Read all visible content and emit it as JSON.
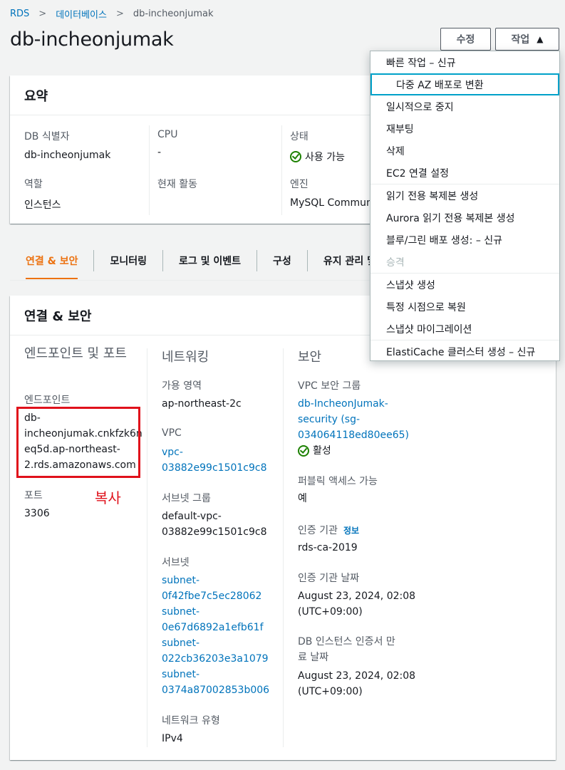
{
  "breadcrumb": {
    "root": "RDS",
    "databases": "데이터베이스",
    "current": "db-incheonjumak"
  },
  "page": {
    "title": "db-incheonjumak"
  },
  "buttons": {
    "edit": "수정",
    "action": "작업",
    "action_caret": "▲"
  },
  "summary": {
    "title": "요약",
    "db_id_label": "DB 식별자",
    "db_id_value": "db-incheonjumak",
    "role_label": "역할",
    "role_value": "인스턴스",
    "cpu_label": "CPU",
    "cpu_value": "-",
    "activity_label": "현재 활동",
    "status_label": "상태",
    "status_value": "사용 가능",
    "engine_label": "엔진",
    "engine_value": "MySQL Communit"
  },
  "tabs": [
    {
      "label": "연결 & 보안",
      "active": true
    },
    {
      "label": "모니터링"
    },
    {
      "label": "로그 및 이벤트"
    },
    {
      "label": "구성"
    },
    {
      "label": "유지 관리 및"
    }
  ],
  "connectivity": {
    "title": "연결 & 보안",
    "endpoint_section": "엔드포인트 및 포트",
    "endpoint_label": "엔드포인트",
    "endpoint_lines": [
      "db-",
      "incheonjumak.cnkfzk6n",
      "eq5d.ap-northeast-",
      "2.rds.amazonaws.com"
    ],
    "port_label": "포트",
    "port_value": "3306",
    "annotation": "복사",
    "networking_section": "네트워킹",
    "az_label": "가용 영역",
    "az_value": "ap-northeast-2c",
    "vpc_label": "VPC",
    "vpc_lines": [
      "vpc-",
      "03882e99c1501c9c8"
    ],
    "subnet_group_label": "서브넷 그룹",
    "subnet_group_lines": [
      "default-vpc-",
      "03882e99c1501c9c8"
    ],
    "subnets_label": "서브넷",
    "subnet_lines": [
      "subnet-",
      "0f42fbe7c5ec28062",
      "subnet-",
      "0e67d6892a1efb61f",
      "subnet-",
      "022cb36203e3a1079",
      "subnet-",
      "0374a87002853b006"
    ],
    "network_type_label": "네트워크 유형",
    "network_type_value": "IPv4",
    "security_section": "보안",
    "sg_label": "VPC 보안 그룹",
    "sg_lines": [
      "db-IncheonJumak-",
      "security (sg-",
      "034064118ed80ee65)"
    ],
    "sg_status": "활성",
    "public_label": "퍼블릭 액세스 가능",
    "public_value": "예",
    "ca_label": "인증 기관",
    "ca_info": "정보",
    "ca_value": "rds-ca-2019",
    "ca_date_label": "인증 기관 날짜",
    "ca_date_lines": [
      "August 23, 2024, 02:08",
      "(UTC+09:00)"
    ],
    "cert_label_lines": [
      "DB 인스턴스 인증서 만",
      "료 날짜"
    ],
    "cert_date_lines": [
      "August 23, 2024, 02:08",
      "(UTC+09:00)"
    ]
  },
  "dropdown": {
    "items": [
      "빠른 작업 – 신규",
      "다중 AZ 배포로 변환",
      "일시적으로 중지",
      "재부팅",
      "삭제",
      "EC2 연결 설정",
      "읽기 전용 복제본 생성",
      "Aurora 읽기 전용 복제본 생성",
      "블루/그린 배포 생성: – 신규",
      "승격",
      "스냅샷 생성",
      "특정 시점으로 복원",
      "스냅샷 마이그레이션",
      "ElastiCache 클러스터 생성 – 신규"
    ]
  },
  "colors": {
    "link": "#0073bb",
    "accent": "#ec7211",
    "success": "#1d8102",
    "highlight": "#e0111b"
  }
}
